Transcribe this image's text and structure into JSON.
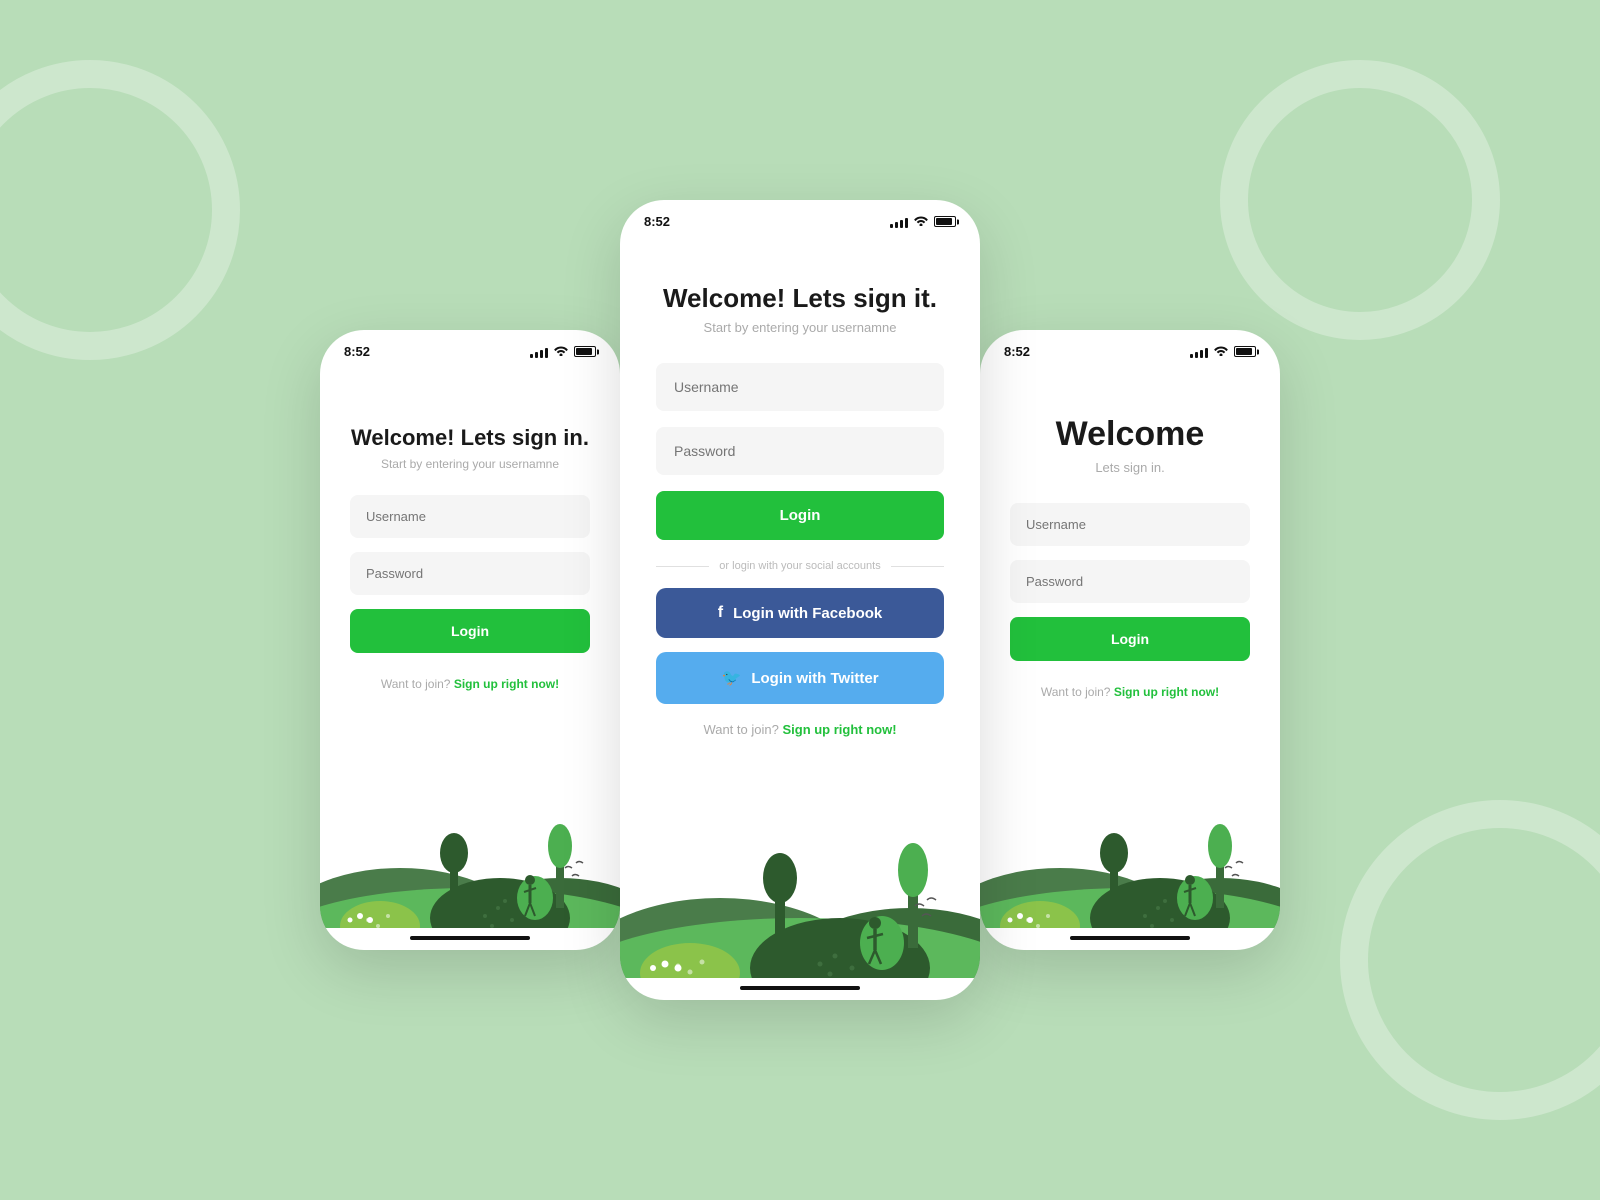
{
  "background": {
    "color": "#b8ddb8"
  },
  "phones": {
    "left": {
      "time": "8:52",
      "title": "Welcome! Lets sign in.",
      "subtitle": "Start by entering your usernamne",
      "username_placeholder": "Username",
      "password_placeholder": "Password",
      "login_button": "Login",
      "signup_text": "Want to join?",
      "signup_link": "Sign up right now!"
    },
    "center": {
      "time": "8:52",
      "title": "Welcome! Lets sign it.",
      "subtitle": "Start by entering your usernamne",
      "username_placeholder": "Username",
      "password_placeholder": "Password",
      "login_button": "Login",
      "divider_text": "or login with your social accounts",
      "facebook_button": "Login with Facebook",
      "twitter_button": "Login with Twitter",
      "signup_text": "Want to join?",
      "signup_link": "Sign up right now!"
    },
    "right": {
      "time": "8:52",
      "title": "Welcome",
      "subtitle": "Lets sign in.",
      "username_placeholder": "Username",
      "password_placeholder": "Password",
      "login_button": "Login",
      "signup_text": "Want to join?",
      "signup_link": "Sign up right now!"
    }
  }
}
